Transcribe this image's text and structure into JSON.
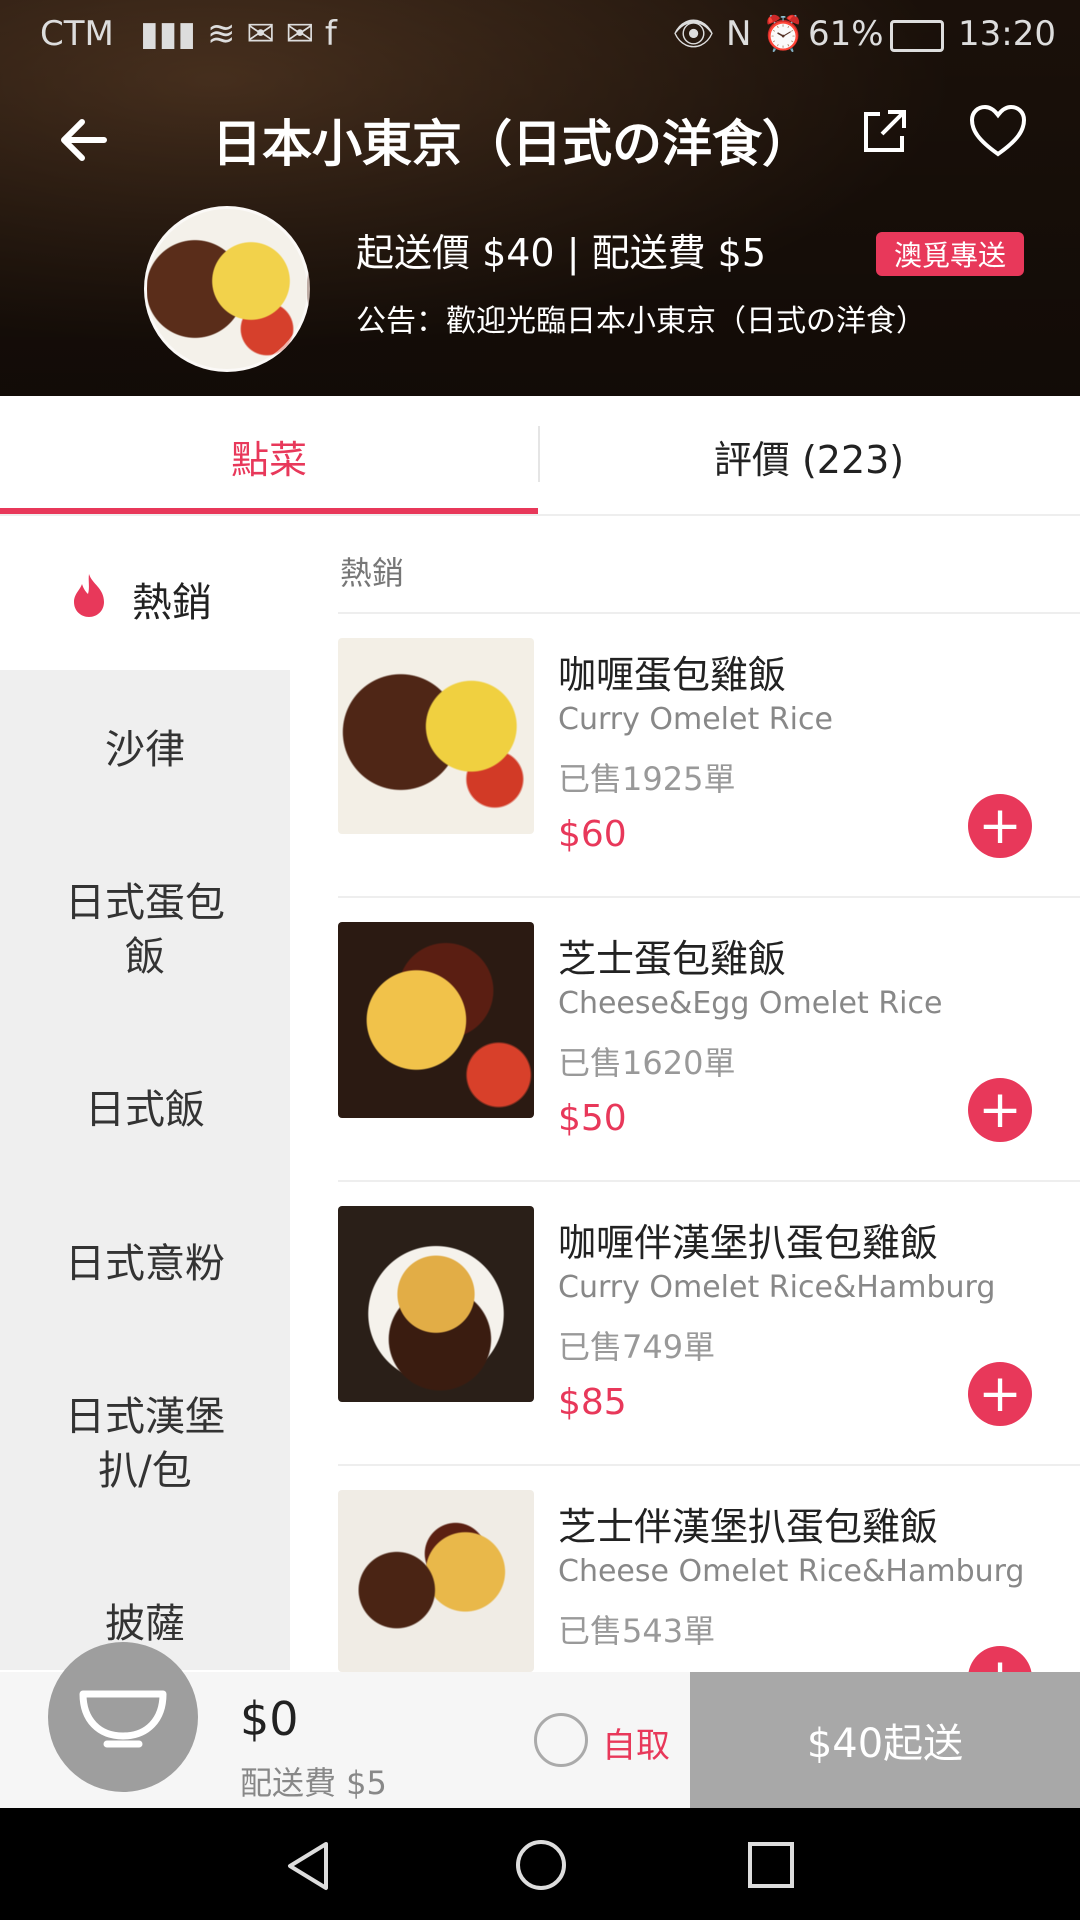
{
  "status_bar": {
    "carrier": "CTM",
    "battery": "61%",
    "time": "13:20"
  },
  "header": {
    "title": "日本小東京（日式の洋食）",
    "min_order": "起送價 $40 | 配送費 $5",
    "delivery_badge": "澳覓專送",
    "notice": "公告：歡迎光臨日本小東京（日式の洋食）"
  },
  "tabs": {
    "order": "點菜",
    "review": "評價 (223)"
  },
  "sidebar": {
    "items": [
      {
        "label": "熱銷"
      },
      {
        "label": "沙律"
      },
      {
        "label": "日式蛋包\n飯"
      },
      {
        "label": "日式飯"
      },
      {
        "label": "日式意粉"
      },
      {
        "label": "日式漢堡\n扒/包"
      },
      {
        "label": "披薩"
      }
    ]
  },
  "section_title": "熱銷",
  "dishes": [
    {
      "name_cn": "咖喱蛋包雞飯",
      "name_en": "Curry Omelet Rice",
      "sold": "已售1925單",
      "price": "$60"
    },
    {
      "name_cn": "芝士蛋包雞飯",
      "name_en": "Cheese&Egg Omelet Rice",
      "sold": "已售1620單",
      "price": "$50"
    },
    {
      "name_cn": "咖喱伴漢堡扒蛋包雞飯",
      "name_en": "Curry Omelet Rice&Hamburg",
      "sold": "已售749單",
      "price": "$85"
    },
    {
      "name_cn": "芝士伴漢堡扒蛋包雞飯",
      "name_en": "Cheese Omelet Rice&Hamburg",
      "sold": "已售543單",
      "price": ""
    }
  ],
  "cart": {
    "total": "$0",
    "delivery_fee": "配送費 $5",
    "pickup_label": "自取",
    "checkout_label": "$40起送"
  },
  "colors": {
    "accent": "#e8385a",
    "checkout_bg": "#a8a8a8"
  }
}
